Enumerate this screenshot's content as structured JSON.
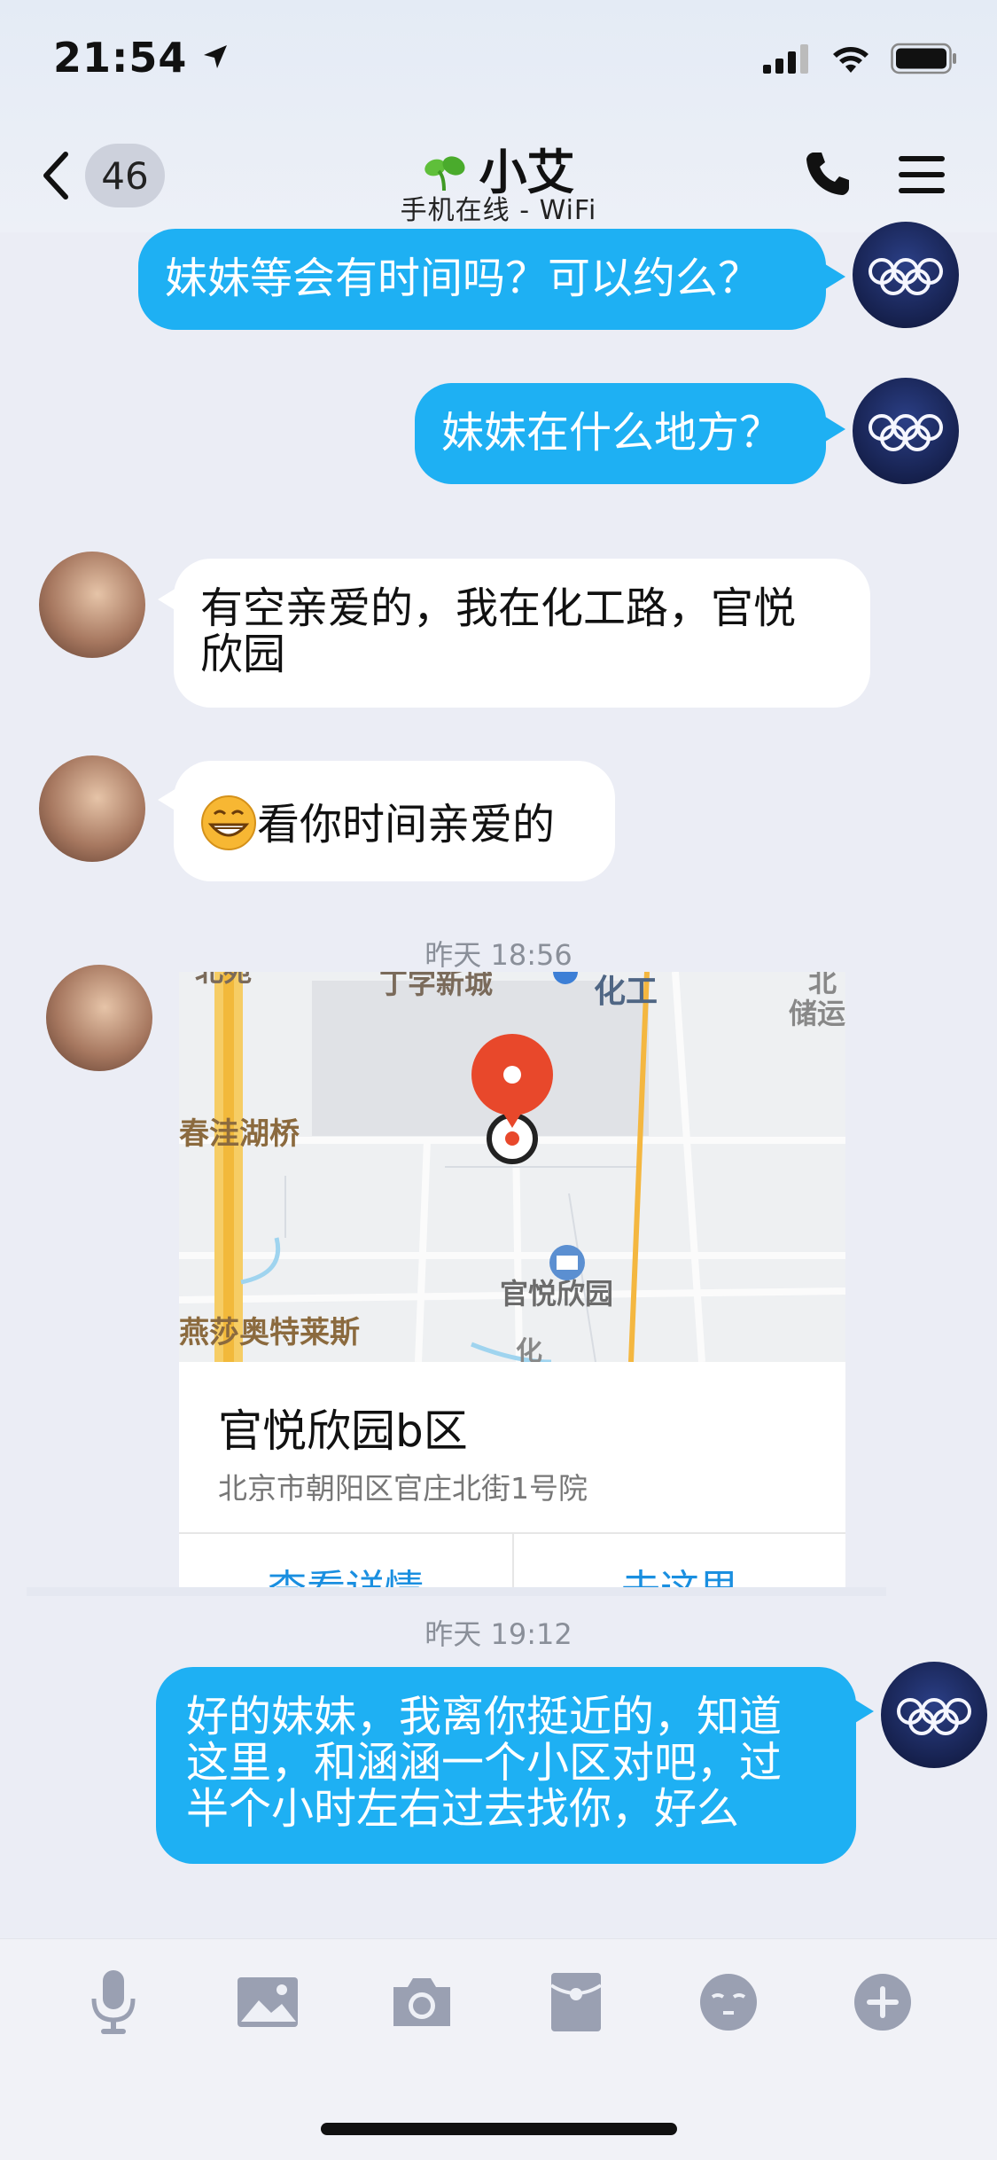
{
  "status": {
    "time": "21:54"
  },
  "nav": {
    "back_badge": "46",
    "title": "小艾",
    "subtitle": "手机在线 - WiFi"
  },
  "messages": [
    {
      "side": "out",
      "text": "妹妹等会有时间吗？可以约么？"
    },
    {
      "side": "out",
      "text": "妹妹在什么地方？"
    },
    {
      "side": "in",
      "line1": "有空亲爱的，我在化工路，官悦",
      "line2": "欣园"
    },
    {
      "side": "in",
      "text": "看你时间亲爱的"
    }
  ],
  "timestamp1": "昨天 18:56",
  "location": {
    "name": "官悦欣园b区",
    "address": "北京市朝阳区官庄北街1号院",
    "detail_button": "查看详情",
    "go_button": "去这里",
    "map_labels": {
      "top_left": "北苑",
      "top_mid": "丁字新城",
      "chemical": "化工",
      "top_right1": "北",
      "top_right2": "储运",
      "bridge": "春洼湖桥",
      "poi": "官悦欣园",
      "outlet": "燕莎奥特莱斯",
      "road": "化"
    }
  },
  "timestamp2": "昨天 19:12",
  "last_message": {
    "line1": "好的妹妹，我离你挺近的，知道",
    "line2": "这里，和涵涵一个小区对吧，过",
    "line3": "半个小时左右过去找你，好么"
  },
  "colors": {
    "outgoing_bubble": "#1eb0f3",
    "link_blue": "#1a8fe0",
    "pin_red": "#e8482b"
  },
  "toolbar_icons": [
    "microphone-icon",
    "image-icon",
    "camera-icon",
    "red-packet-icon",
    "emoji-icon",
    "plus-icon"
  ]
}
